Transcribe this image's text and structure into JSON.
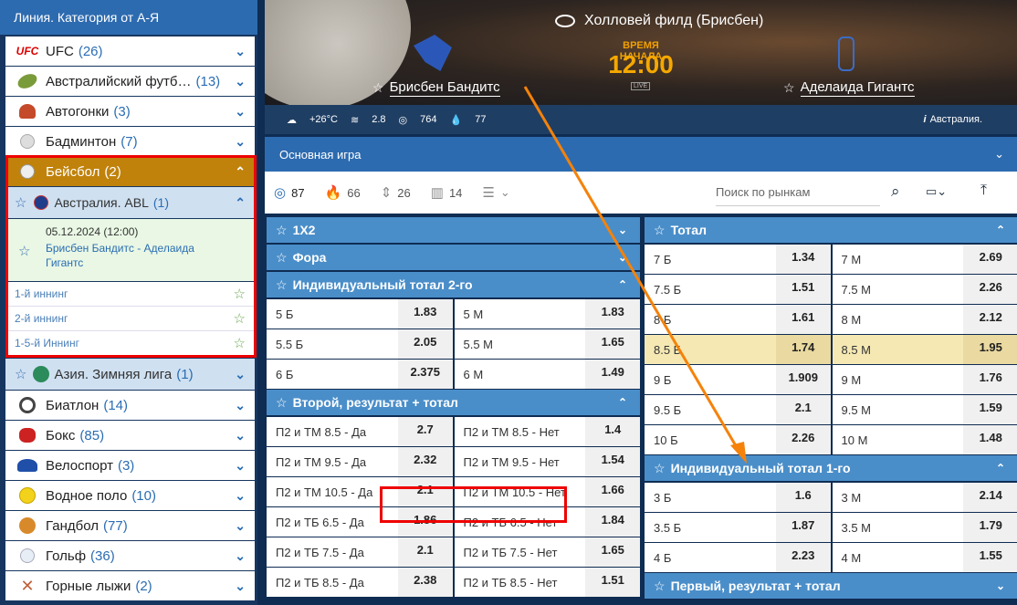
{
  "sidebar": {
    "title": "Линия. Категория от А-Я",
    "items": [
      {
        "label": "UFC",
        "count": "(26)"
      },
      {
        "label": "Австралийский футб…",
        "count": "(13)"
      },
      {
        "label": "Автогонки",
        "count": "(3)"
      },
      {
        "label": "Бадминтон",
        "count": "(7)"
      },
      {
        "label": "Бейсбол",
        "count": "(2)"
      },
      {
        "label": "Австралия. ABL",
        "count": "(1)"
      }
    ],
    "match": {
      "date": "05.12.2024 (12:00)",
      "teams": "Брисбен Бандитс - Аделаида Гигантс"
    },
    "innings": [
      "1-й иннинг",
      "2-й иннинг",
      "1-5-й Иннинг"
    ],
    "items2": [
      {
        "label": "Азия. Зимняя лига",
        "count": "(1)"
      },
      {
        "label": "Биатлон",
        "count": "(14)"
      },
      {
        "label": "Бокс",
        "count": "(85)"
      },
      {
        "label": "Велоспорт",
        "count": "(3)"
      },
      {
        "label": "Водное поло",
        "count": "(10)"
      },
      {
        "label": "Гандбол",
        "count": "(77)"
      },
      {
        "label": "Гольф",
        "count": "(36)"
      },
      {
        "label": "Горные лыжи",
        "count": "(2)"
      }
    ]
  },
  "header": {
    "stadium": "Холловей филд (Брисбен)",
    "start_label": "ВРЕМЯ НАЧАЛА",
    "start_time": "12:00",
    "live": "LIVE",
    "team1": "Брисбен Бандитс",
    "team2": "Аделаида Гигантс",
    "weather": {
      "temp": "+26°C",
      "wind": "2.8",
      "pressure": "764",
      "humidity": "77"
    },
    "country": "Австралия."
  },
  "main": {
    "bar_label": "Основная игра",
    "filters": {
      "all": "87",
      "hot": "66",
      "ou": "26",
      "stats": "14"
    },
    "search_placeholder": "Поиск по рынкам"
  },
  "left_markets": [
    {
      "title": "1Х2",
      "rows": []
    },
    {
      "title": "Фора",
      "rows": []
    },
    {
      "title": "Индивидуальный тотал 2-го",
      "rows": [
        [
          "5 Б",
          "1.83",
          "5 М",
          "1.83"
        ],
        [
          "5.5 Б",
          "2.05",
          "5.5 М",
          "1.65"
        ],
        [
          "6 Б",
          "2.375",
          "6 М",
          "1.49"
        ]
      ]
    },
    {
      "title": "Второй, результат + тотал",
      "rows": [
        [
          "П2 и ТМ 8.5 - Да",
          "2.7",
          "П2 и ТМ 8.5 - Нет",
          "1.4"
        ],
        [
          "П2 и ТМ 9.5 - Да",
          "2.32",
          "П2 и ТМ 9.5 - Нет",
          "1.54"
        ],
        [
          "П2 и ТМ 10.5 - Да",
          "2.1",
          "П2 и ТМ 10.5 - Нет",
          "1.66"
        ],
        [
          "П2 и ТБ 6.5 - Да",
          "1.86",
          "П2 и ТБ 6.5 - Нет",
          "1.84"
        ],
        [
          "П2 и ТБ 7.5 - Да",
          "2.1",
          "П2 и ТБ 7.5 - Нет",
          "1.65"
        ],
        [
          "П2 и ТБ 8.5 - Да",
          "2.38",
          "П2 и ТБ 8.5 - Нет",
          "1.51"
        ]
      ]
    }
  ],
  "right_markets": [
    {
      "title": "Тотал",
      "rows": [
        [
          "7 Б",
          "1.34",
          "7 М",
          "2.69"
        ],
        [
          "7.5 Б",
          "1.51",
          "7.5 М",
          "2.26"
        ],
        [
          "8 Б",
          "1.61",
          "8 М",
          "2.12"
        ],
        [
          "8.5 Б",
          "1.74",
          "8.5 М",
          "1.95"
        ],
        [
          "9 Б",
          "1.909",
          "9 М",
          "1.76"
        ],
        [
          "9.5 Б",
          "2.1",
          "9.5 М",
          "1.59"
        ],
        [
          "10 Б",
          "2.26",
          "10 М",
          "1.48"
        ]
      ]
    },
    {
      "title": "Индивидуальный тотал 1-го",
      "rows": [
        [
          "3 Б",
          "1.6",
          "3 М",
          "2.14"
        ],
        [
          "3.5 Б",
          "1.87",
          "3.5 М",
          "1.79"
        ],
        [
          "4 Б",
          "2.23",
          "4 М",
          "1.55"
        ]
      ]
    },
    {
      "title": "Первый, результат + тотал",
      "rows": []
    }
  ]
}
